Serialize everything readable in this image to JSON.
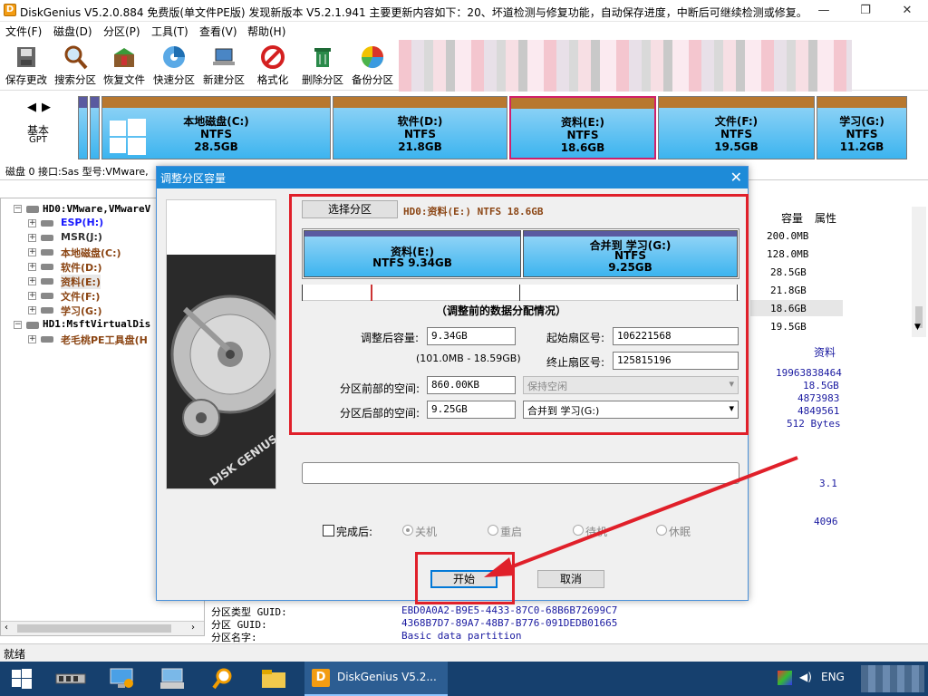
{
  "app": {
    "title": "DiskGenius V5.2.0.884 免费版(单文件PE版)   发现新版本 V5.2.1.941 主要更新内容如下：20、坏道检测与修复功能，自动保存进度，中断后可继续检测或修复。",
    "icon_letter": "D"
  },
  "menu": [
    "文件(F)",
    "磁盘(D)",
    "分区(P)",
    "工具(T)",
    "查看(V)",
    "帮助(H)"
  ],
  "toolbar": [
    "保存更改",
    "搜索分区",
    "恢复文件",
    "快速分区",
    "新建分区",
    "格式化",
    "删除分区",
    "备份分区"
  ],
  "disk_map": {
    "left_label_1": "基本",
    "left_label_2": "GPT",
    "partitions": [
      {
        "name": "本地磁盘(C:)",
        "fs": "NTFS",
        "size": "28.5GB"
      },
      {
        "name": "软件(D:)",
        "fs": "NTFS",
        "size": "21.8GB"
      },
      {
        "name": "资料(E:)",
        "fs": "NTFS",
        "size": "18.6GB"
      },
      {
        "name": "文件(F:)",
        "fs": "NTFS",
        "size": "19.5GB"
      },
      {
        "name": "学习(G:)",
        "fs": "NTFS",
        "size": "11.2GB"
      }
    ]
  },
  "disk_info": "磁盘 0 接口:Sas  型号:VMware,",
  "tree": {
    "hd0": "HD0:VMware,VMwareV",
    "items": [
      "ESP(H:)",
      "MSR(J:)",
      "本地磁盘(C:)",
      "软件(D:)",
      "资料(E:)",
      "文件(F:)",
      "学习(G:)"
    ],
    "hd1": "HD1:MsftVirtualDis",
    "hd1_item": "老毛桃PE工具盘(H"
  },
  "table": {
    "headers": [
      "容量",
      "属性"
    ],
    "capacities": [
      "200.0MB",
      "128.0MB",
      "28.5GB",
      "21.8GB",
      "18.6GB",
      "19.5GB"
    ]
  },
  "details": {
    "name": "资料",
    "values": [
      "19963838464",
      "18.5GB",
      "4873983",
      "4849561",
      "512 Bytes"
    ],
    "v1": "3.1",
    "v2": "4096",
    "guid_rows": [
      {
        "label": "分区类型 GUID:",
        "value": "EBD0A0A2-B9E5-4433-87C0-68B6B72699C7"
      },
      {
        "label": "分区 GUID:",
        "value": "4368B7D7-89A7-48B7-B776-091DEDB01665"
      },
      {
        "label": "分区名字:",
        "value": "Basic data partition"
      }
    ]
  },
  "dialog": {
    "title": "调整分区容量",
    "close": "✕",
    "select_button": "选择分区",
    "selected_info": "HD0:资料(E:) NTFS 18.6GB",
    "bar_left": {
      "name": "资料(E:)",
      "info": "NTFS 9.34GB"
    },
    "bar_right": {
      "name": "合并到 学习(G:)",
      "fs": "NTFS",
      "size": "9.25GB"
    },
    "caption": "（调整前的数据分配情况）",
    "after_size_label": "调整后容量:",
    "after_size_value": "9.34GB",
    "range": "(101.0MB - 18.59GB)",
    "start_sector_label": "起始扇区号:",
    "start_sector_value": "106221568",
    "end_sector_label": "终止扇区号:",
    "end_sector_value": "125815196",
    "front_space_label": "分区前部的空间:",
    "front_space_value": "860.00KB",
    "front_option": "保持空闲",
    "back_space_label": "分区后部的空间:",
    "back_space_value": "9.25GB",
    "back_option": "合并到 学习(G:)",
    "after_complete_label": "完成后:",
    "options": [
      "关机",
      "重启",
      "待机",
      "休眠"
    ],
    "start_button": "开始",
    "cancel_button": "取消",
    "logo_text": "DISK GENIUS"
  },
  "status": "就绪",
  "taskbar": {
    "active": "DiskGenius V5.2...",
    "lang": "ENG"
  }
}
